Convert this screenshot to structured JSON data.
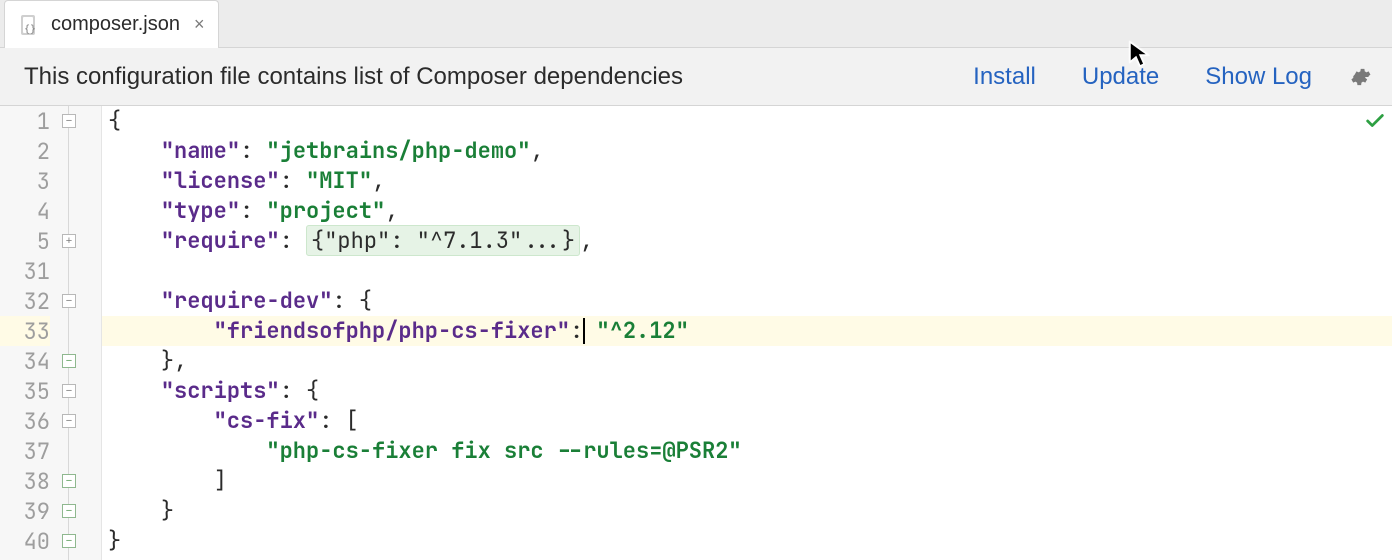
{
  "tab": {
    "filename": "composer.json",
    "close_glyph": "×"
  },
  "info_bar": {
    "message": "This configuration file contains list of Composer dependencies",
    "actions": {
      "install": "Install",
      "update": "Update",
      "showlog": "Show Log"
    }
  },
  "editor": {
    "line_numbers": [
      "1",
      "2",
      "3",
      "4",
      "5",
      "31",
      "32",
      "33",
      "34",
      "35",
      "36",
      "37",
      "38",
      "39",
      "40"
    ],
    "highlight_index": 7,
    "folds": [
      {
        "row": 0,
        "glyph": "−"
      },
      {
        "row": 4,
        "glyph": "+"
      },
      {
        "row": 6,
        "glyph": "−"
      },
      {
        "row": 8,
        "glyph": "−",
        "changed": true
      },
      {
        "row": 9,
        "glyph": "−"
      },
      {
        "row": 10,
        "glyph": "−"
      },
      {
        "row": 12,
        "glyph": "−",
        "changed": true
      },
      {
        "row": 13,
        "glyph": "−",
        "changed": true
      },
      {
        "row": 14,
        "glyph": "−",
        "changed": true
      }
    ],
    "rows": [
      {
        "indent": 0,
        "segs": [
          {
            "t": "{",
            "c": "k-punc"
          }
        ]
      },
      {
        "indent": 1,
        "segs": [
          {
            "t": "\"name\"",
            "c": "k-key"
          },
          {
            "t": ": ",
            "c": "k-punc"
          },
          {
            "t": "\"jetbrains/php-demo\"",
            "c": "k-str"
          },
          {
            "t": ",",
            "c": "k-punc"
          }
        ]
      },
      {
        "indent": 1,
        "segs": [
          {
            "t": "\"license\"",
            "c": "k-key"
          },
          {
            "t": ": ",
            "c": "k-punc"
          },
          {
            "t": "\"MIT\"",
            "c": "k-str"
          },
          {
            "t": ",",
            "c": "k-punc"
          }
        ]
      },
      {
        "indent": 1,
        "segs": [
          {
            "t": "\"type\"",
            "c": "k-key"
          },
          {
            "t": ": ",
            "c": "k-punc"
          },
          {
            "t": "\"project\"",
            "c": "k-str"
          },
          {
            "t": ",",
            "c": "k-punc"
          }
        ]
      },
      {
        "indent": 1,
        "segs": [
          {
            "t": "\"require\"",
            "c": "k-key"
          },
          {
            "t": ": ",
            "c": "k-punc"
          },
          {
            "t": "{\"php\": \"^7.1.3\"...}",
            "c": "folded"
          },
          {
            "t": ",",
            "c": "k-punc"
          }
        ]
      },
      {
        "indent": 1,
        "segs": []
      },
      {
        "indent": 1,
        "segs": [
          {
            "t": "\"require-dev\"",
            "c": "k-key"
          },
          {
            "t": ": {",
            "c": "k-punc"
          }
        ]
      },
      {
        "indent": 2,
        "segs": [
          {
            "t": "\"friendsofphp/php-cs-fixer\"",
            "c": "k-key"
          },
          {
            "t": ": ",
            "c": "k-punc"
          },
          {
            "t": "\"^2.12\"",
            "c": "k-str"
          }
        ],
        "caret_after": true
      },
      {
        "indent": 1,
        "segs": [
          {
            "t": "},",
            "c": "k-punc"
          }
        ]
      },
      {
        "indent": 1,
        "segs": [
          {
            "t": "\"scripts\"",
            "c": "k-key"
          },
          {
            "t": ": {",
            "c": "k-punc"
          }
        ]
      },
      {
        "indent": 2,
        "segs": [
          {
            "t": "\"cs-fix\"",
            "c": "k-key"
          },
          {
            "t": ": [",
            "c": "k-punc"
          }
        ]
      },
      {
        "indent": 3,
        "segs": [
          {
            "t": "\"php-cs-fixer fix src --rules=@PSR2\"",
            "c": "k-str"
          }
        ]
      },
      {
        "indent": 2,
        "segs": [
          {
            "t": "]",
            "c": "k-punc"
          }
        ]
      },
      {
        "indent": 1,
        "segs": [
          {
            "t": "}",
            "c": "k-punc"
          }
        ]
      },
      {
        "indent": 0,
        "segs": [
          {
            "t": "}",
            "c": "k-punc"
          }
        ]
      }
    ]
  }
}
